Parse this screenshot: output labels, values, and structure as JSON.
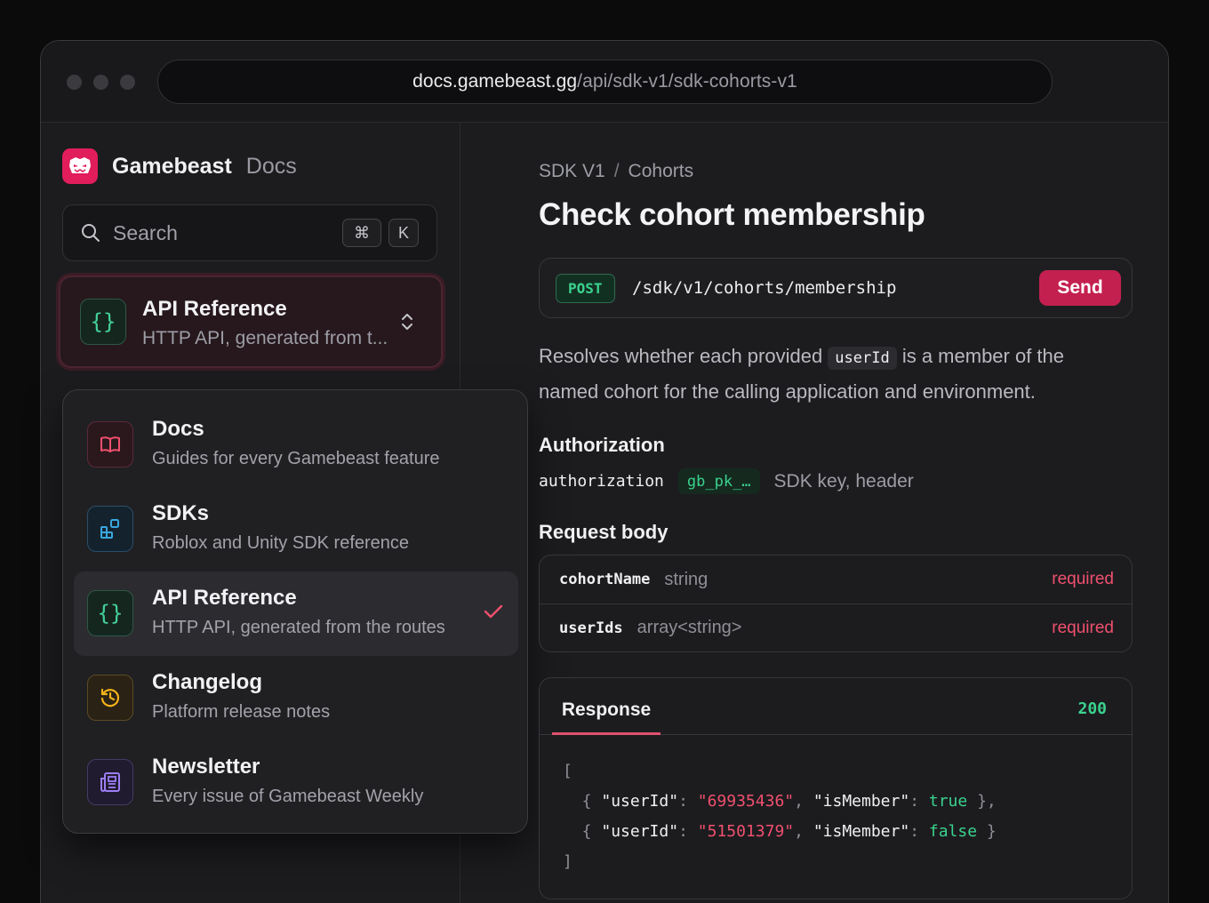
{
  "browser": {
    "url_host": "docs.gamebeast.gg",
    "url_path": "/api/sdk-v1/sdk-cohorts-v1"
  },
  "brand": {
    "name": "Gamebeast",
    "section": "Docs"
  },
  "search": {
    "placeholder": "Search",
    "shortcut_mod": "⌘",
    "shortcut_key": "K"
  },
  "selector": {
    "title": "API Reference",
    "subtitle": "HTTP API, generated from t...",
    "icon": "braces-icon"
  },
  "dropdown": {
    "items": [
      {
        "title": "Docs",
        "subtitle": "Guides for every Gamebeast feature",
        "icon": "book-icon",
        "color": "#f0506e",
        "active": false
      },
      {
        "title": "SDKs",
        "subtitle": "Roblox and Unity SDK reference",
        "icon": "blocks-icon",
        "color": "#3aa6e0",
        "active": false
      },
      {
        "title": "API Reference",
        "subtitle": "HTTP API, generated from the routes",
        "icon": "braces-icon",
        "color": "#44d19a",
        "active": true
      },
      {
        "title": "Changelog",
        "subtitle": "Platform release notes",
        "icon": "history-icon",
        "color": "#f2b21c",
        "active": false
      },
      {
        "title": "Newsletter",
        "subtitle": "Every issue of Gamebeast Weekly",
        "icon": "newspaper-icon",
        "color": "#9d7df5",
        "active": false
      }
    ]
  },
  "breadcrumb": {
    "parent": "SDK V1",
    "separator": "/",
    "current": "Cohorts"
  },
  "page_title": "Check cohort membership",
  "endpoint": {
    "method": "POST",
    "path": "/sdk/v1/cohorts/membership",
    "send_label": "Send"
  },
  "description": {
    "before": "Resolves whether each provided ",
    "code": "userId",
    "after": " is a member of the named cohort for the calling application and environment."
  },
  "authorization": {
    "heading": "Authorization",
    "key": "authorization",
    "value": "gb_pk_…",
    "desc": "SDK key, header"
  },
  "request_body": {
    "heading": "Request body",
    "fields": [
      {
        "name": "cohortName",
        "type": "string",
        "required": "required"
      },
      {
        "name": "userIds",
        "type": "array<string>",
        "required": "required"
      }
    ]
  },
  "response": {
    "tab": "Response",
    "status": "200",
    "rows": [
      {
        "userId": "\"69935436\"",
        "isMember": "true"
      },
      {
        "userId": "\"51501379\"",
        "isMember": "false"
      }
    ],
    "key_userId": "\"userId\"",
    "key_isMember": "\"isMember\"",
    "open_bracket": "[",
    "close_bracket": "]"
  },
  "colors": {
    "accent": "#c4204f",
    "success": "#3ad28d",
    "danger": "#f0506e"
  }
}
